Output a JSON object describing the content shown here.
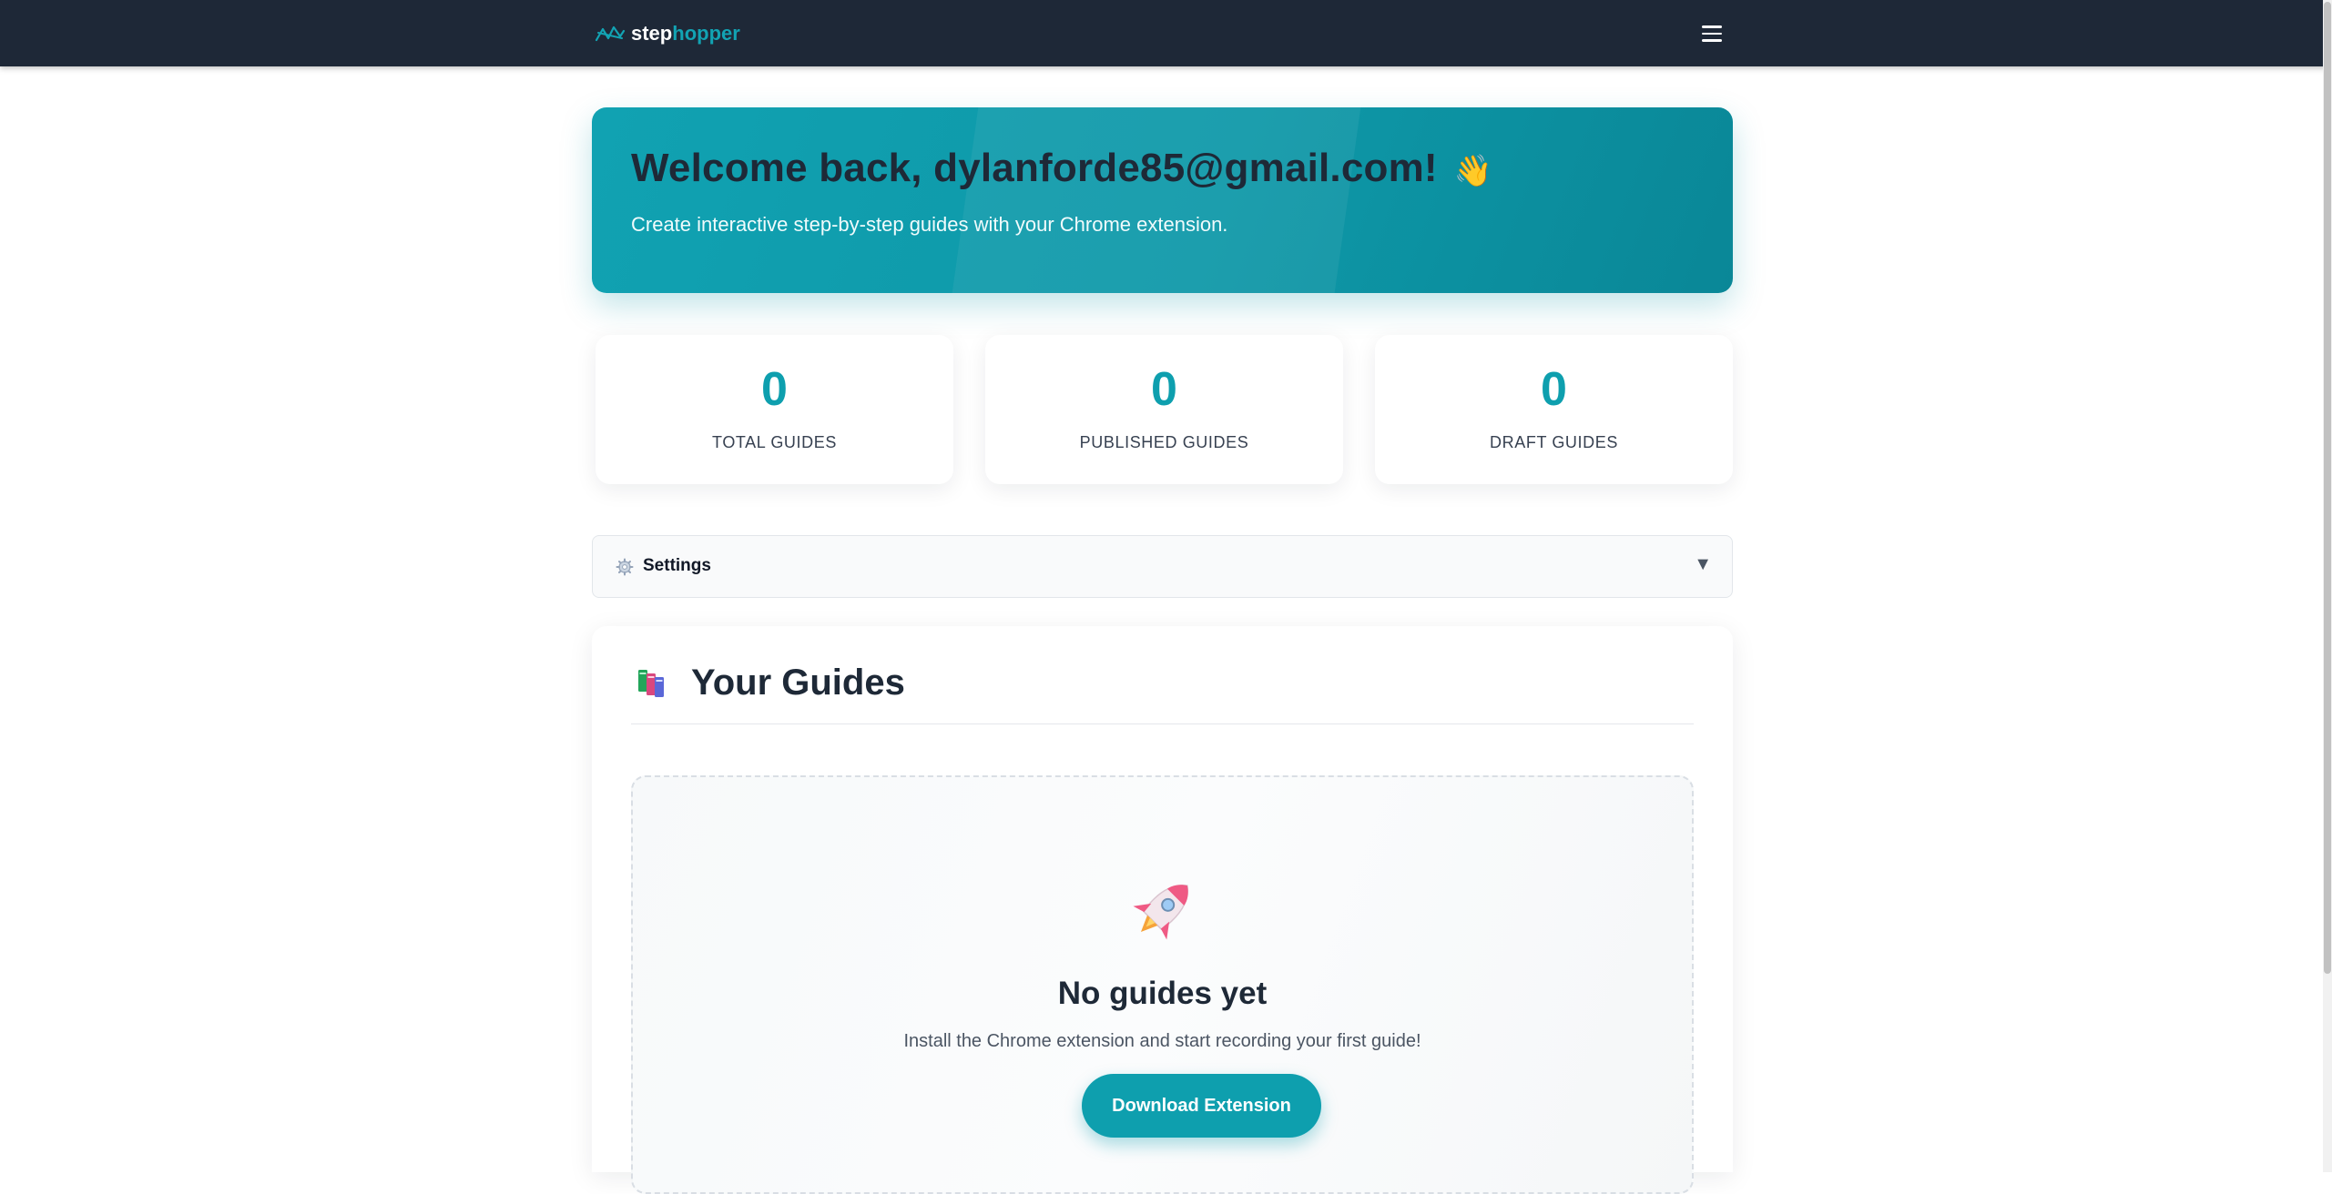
{
  "brand": {
    "part1": "step",
    "part2": "hopper",
    "icon": "stephopper-logo-icon"
  },
  "navbar": {
    "menu_icon": "hamburger-menu-icon"
  },
  "hero": {
    "title": "Welcome back, dylanforde85@gmail.com!",
    "emoji": "👋",
    "subtitle": "Create interactive step-by-step guides with your Chrome extension."
  },
  "stats": [
    {
      "value": "0",
      "label": "TOTAL GUIDES"
    },
    {
      "value": "0",
      "label": "PUBLISHED GUIDES"
    },
    {
      "value": "0",
      "label": "DRAFT GUIDES"
    }
  ],
  "settings": {
    "label": "Settings",
    "icon": "gear-icon",
    "caret": "▼"
  },
  "guides": {
    "title": "Your Guides",
    "icon": "books-icon",
    "empty": {
      "icon": "rocket-icon",
      "title": "No guides yet",
      "subtitle": "Install the Chrome extension and start recording your first guide!",
      "button_label": "Download Extension"
    }
  },
  "colors": {
    "navbar": "#1e2837",
    "accent": "#0e9fae",
    "brand_highlight": "#12a3b3"
  }
}
